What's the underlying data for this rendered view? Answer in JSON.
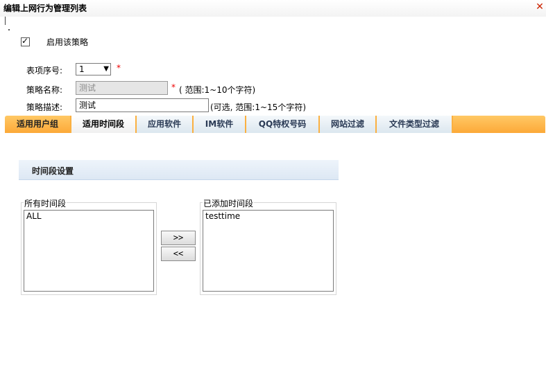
{
  "window": {
    "title": "编辑上网行为管理列表",
    "close_glyph": "✕"
  },
  "enable": {
    "checked": true,
    "label": "启用该策略"
  },
  "form": {
    "index_label": "表项序号:",
    "index_value": "1",
    "name_label": "策略名称:",
    "name_value": "测试",
    "name_hint": "( 范围:1~10个字符)",
    "desc_label": "策略描述:",
    "desc_value": "测试",
    "desc_hint": "(可选, 范围:1~15个字符)",
    "required_mark": "*"
  },
  "tabs": [
    {
      "label": "适用用户组"
    },
    {
      "label": "适用时间段"
    },
    {
      "label": "应用软件"
    },
    {
      "label": "IM软件"
    },
    {
      "label": "QQ特权号码"
    },
    {
      "label": "网站过滤"
    },
    {
      "label": "文件类型过滤"
    }
  ],
  "active_tab": "适用时间段",
  "section": {
    "title": "时间段设置"
  },
  "available": {
    "legend": "所有时间段",
    "items": [
      "ALL"
    ]
  },
  "added": {
    "legend": "已添加时间段",
    "items": [
      "testtime"
    ]
  },
  "buttons": {
    "add": ">>",
    "remove": "<<"
  },
  "colors": {
    "tab_bar": "#fca938",
    "required": "#e00000",
    "close": "#cc2200"
  }
}
